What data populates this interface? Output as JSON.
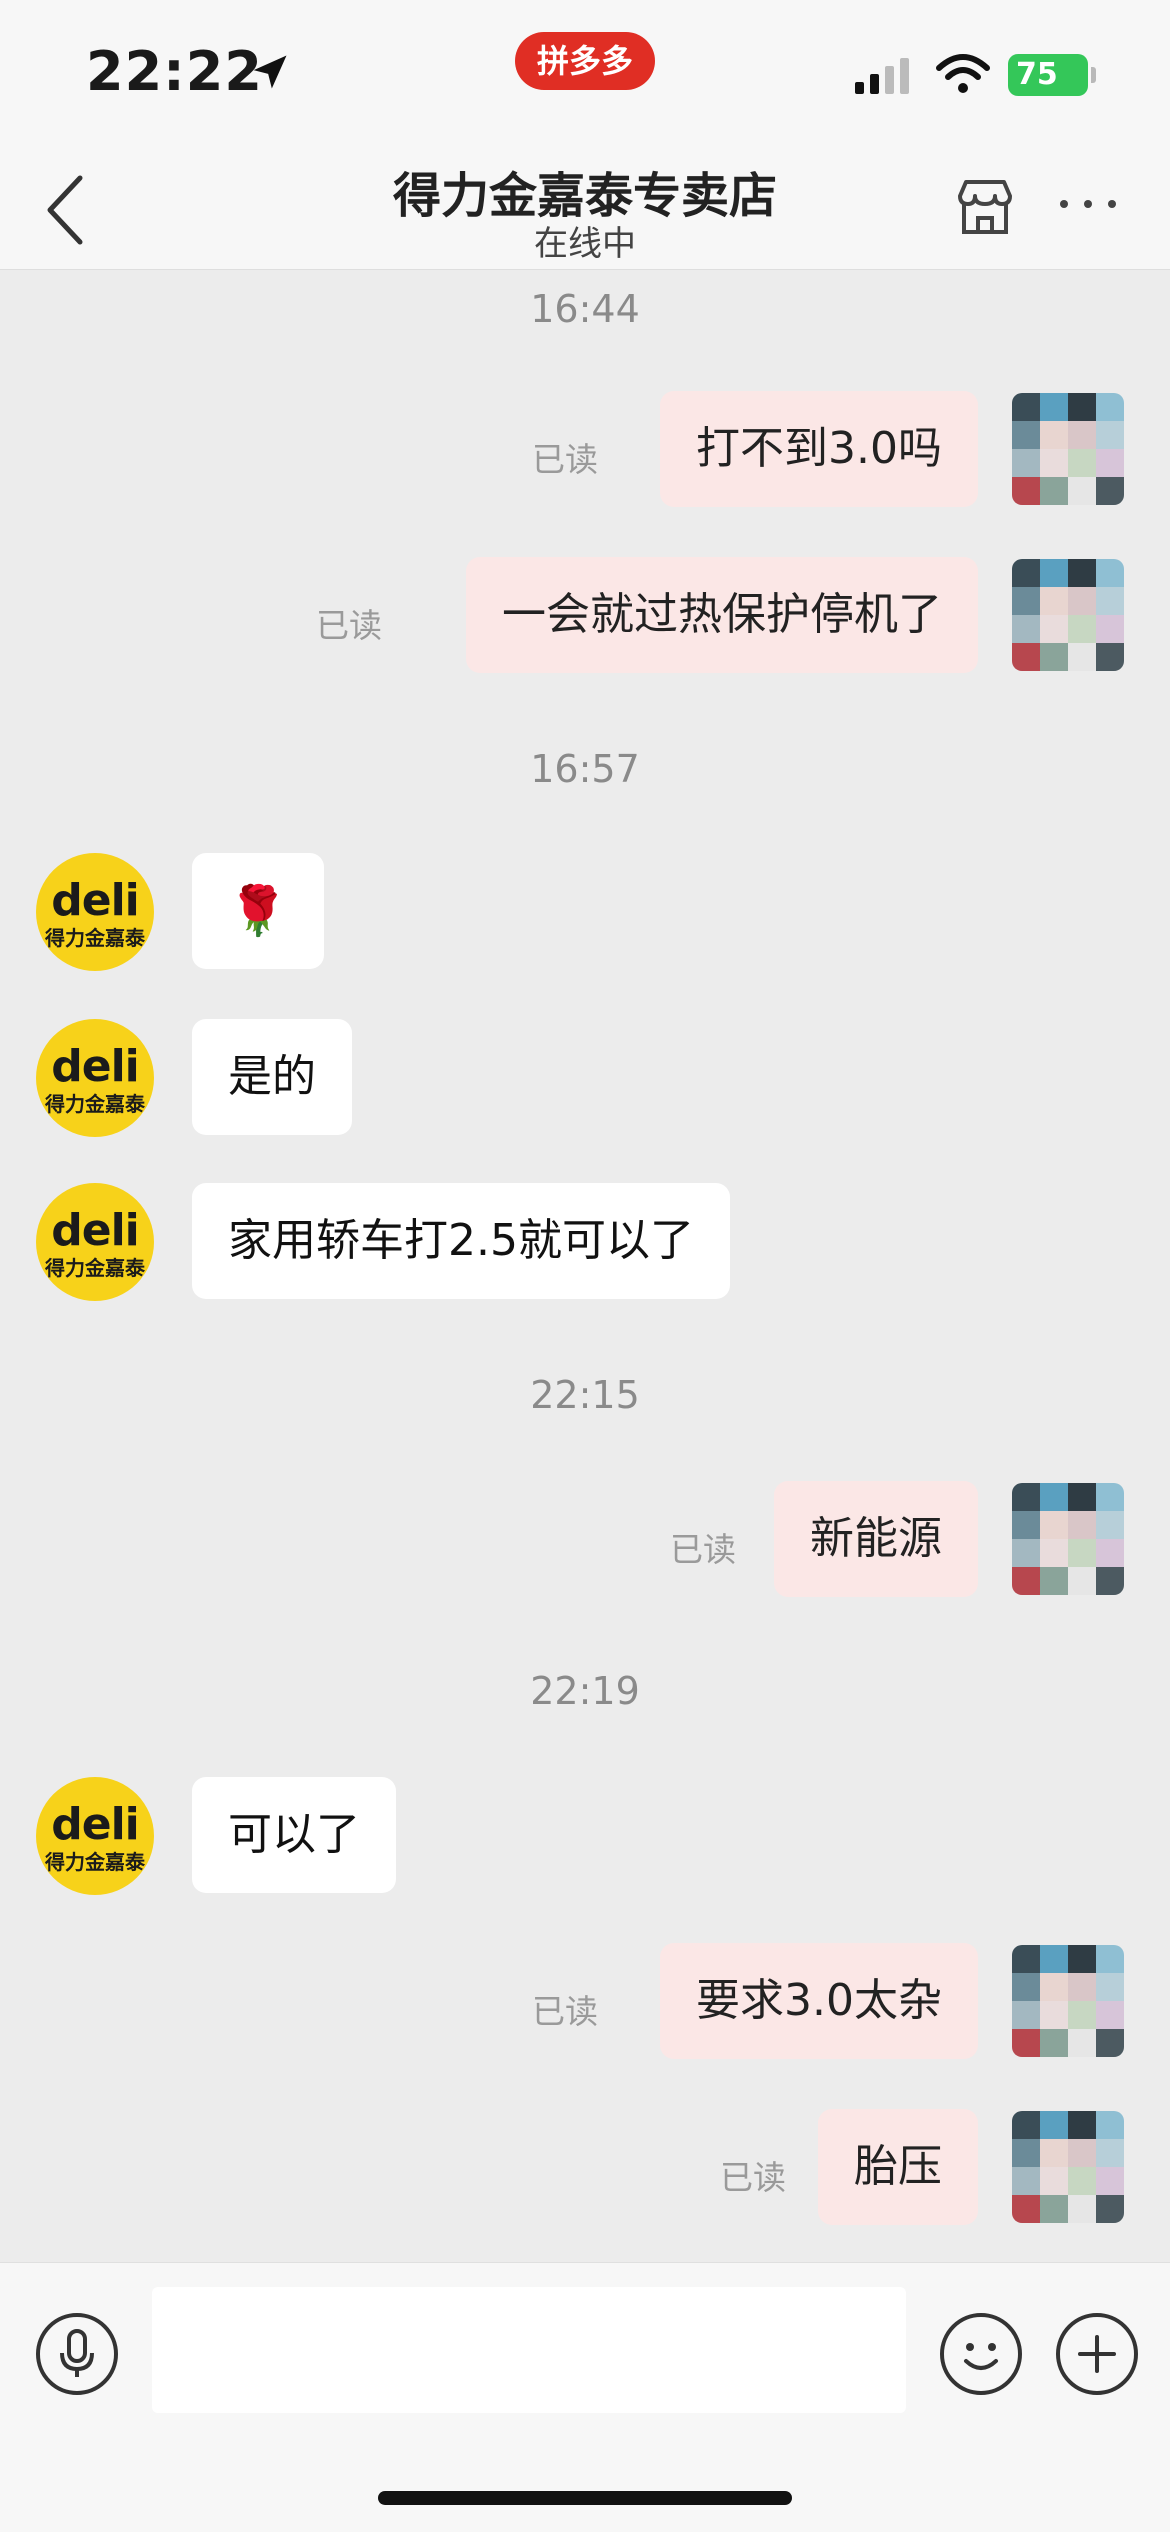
{
  "status": {
    "time": "22:22",
    "battery": "75"
  },
  "brand": {
    "label": "拼多多",
    "color": "#e02e24"
  },
  "header": {
    "title": "得力金嘉泰专卖店",
    "subtitle": "在线中"
  },
  "read_label": "已读",
  "shop_avatar": {
    "logo_text": "deli",
    "sub_text": "得力金嘉泰"
  },
  "timestamps": [
    "16:44",
    "16:57",
    "22:15",
    "22:19"
  ],
  "messages": [
    {
      "from": "me",
      "text": "打不到3.0吗",
      "read": true
    },
    {
      "from": "me",
      "text": "一会就过热保护停机了",
      "read": true
    },
    {
      "from": "shop",
      "text": "🌹"
    },
    {
      "from": "shop",
      "text": "是的"
    },
    {
      "from": "shop",
      "text": "家用轿车打2.5就可以了"
    },
    {
      "from": "me",
      "text": "新能源",
      "read": true
    },
    {
      "from": "shop",
      "text": "可以了"
    },
    {
      "from": "me",
      "text": "要求3.0太杂",
      "read": true
    },
    {
      "from": "me",
      "text": "胎压",
      "read": true
    }
  ],
  "colors": {
    "background": "#ececec",
    "my_bubble": "#fbe7e6",
    "shop_bubble": "#ffffff",
    "shop_avatar": "#f7d21a"
  }
}
